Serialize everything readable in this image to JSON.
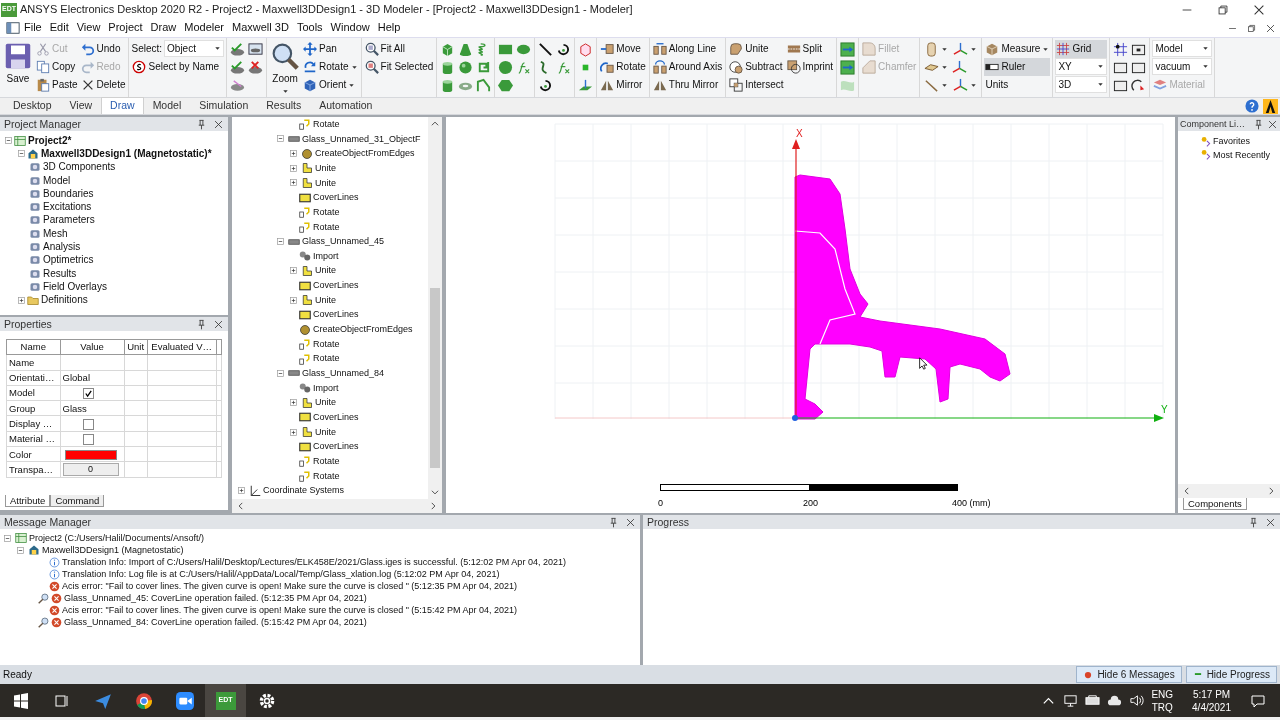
{
  "window": {
    "logo": "EDT",
    "title": "ANSYS Electronics Desktop 2020 R2 - Project2 - Maxwell3DDesign1 - 3D Modeler - [Project2 - Maxwell3DDesign1 - Modeler]"
  },
  "menu": [
    "File",
    "Edit",
    "View",
    "Project",
    "Draw",
    "Modeler",
    "Maxwell 3D",
    "Tools",
    "Window",
    "Help"
  ],
  "ribbon": {
    "groups": [
      {
        "items": [
          {
            "label": "Save"
          },
          {
            "label": "Cut",
            "disabled": true
          },
          {
            "label": "Copy",
            "disabled": false
          },
          {
            "label": "Paste",
            "disabled": false
          },
          {
            "label": "Undo",
            "disabled": false
          },
          {
            "label": "Redo",
            "disabled": true
          },
          {
            "label": "Delete",
            "disabled": false
          }
        ]
      },
      {
        "items": [
          {
            "label": "Select:",
            "value": "Object"
          },
          {
            "label": "Select by Name"
          }
        ]
      },
      {
        "items": [
          {
            "label": "Zoom"
          },
          {
            "label": "Pan"
          },
          {
            "label": "Rotate"
          },
          {
            "label": "Orient"
          }
        ]
      },
      {
        "items": [
          {
            "label": "Fit All"
          },
          {
            "label": "Fit Selected"
          }
        ]
      },
      {
        "items": [
          {
            "label": "Move"
          },
          {
            "label": "Rotate"
          },
          {
            "label": "Mirror"
          }
        ]
      },
      {
        "items": [
          {
            "label": "Along Line"
          },
          {
            "label": "Around Axis"
          },
          {
            "label": "Thru Mirror"
          }
        ]
      },
      {
        "items": [
          {
            "label": "Unite"
          },
          {
            "label": "Subtract"
          },
          {
            "label": "Intersect"
          },
          {
            "label": "Split"
          },
          {
            "label": "Imprint"
          }
        ]
      },
      {
        "items": [
          {
            "label": "Fillet",
            "disabled": true
          },
          {
            "label": "Chamfer",
            "disabled": true
          }
        ]
      },
      {
        "items": [
          {
            "label": "Measure",
            "selected": false
          },
          {
            "label": "Ruler",
            "selected": true
          },
          {
            "label": "Units",
            "selected": false
          }
        ]
      },
      {
        "items": [
          {
            "label": "Grid",
            "selected": true
          },
          {
            "value": "XY"
          },
          {
            "value": "3D"
          }
        ]
      },
      {
        "items": [
          {
            "value": "Model"
          },
          {
            "value": "vacuum"
          },
          {
            "label": "Material",
            "disabled": true
          }
        ]
      }
    ]
  },
  "ribbon_tabs": [
    {
      "label": "Desktop",
      "selected": false
    },
    {
      "label": "View",
      "selected": false
    },
    {
      "label": "Draw",
      "selected": true
    },
    {
      "label": "Model",
      "selected": false
    },
    {
      "label": "Simulation",
      "selected": false
    },
    {
      "label": "Results",
      "selected": false
    },
    {
      "label": "Automation",
      "selected": false
    }
  ],
  "project_manager": {
    "title": "Project Manager",
    "tree": [
      {
        "label": "Project2*",
        "expanded": true,
        "children": [
          {
            "label": "Maxwell3DDesign1 (Magnetostatic)*",
            "expanded": true,
            "children": [
              {
                "label": "3D Components"
              },
              {
                "label": "Model"
              },
              {
                "label": "Boundaries"
              },
              {
                "label": "Excitations"
              },
              {
                "label": "Parameters"
              },
              {
                "label": "Mesh"
              },
              {
                "label": "Analysis"
              },
              {
                "label": "Optimetrics"
              },
              {
                "label": "Results"
              },
              {
                "label": "Field Overlays"
              }
            ]
          },
          {
            "label": "Definitions",
            "expanded": false
          }
        ]
      }
    ]
  },
  "properties": {
    "title": "Properties",
    "columns": [
      "Name",
      "Value",
      "Unit",
      "Evaluated V…"
    ],
    "rows": [
      {
        "name": "Name",
        "kind": "text"
      },
      {
        "name": "Orientati…",
        "kind": "text",
        "value": "Global"
      },
      {
        "name": "Model",
        "kind": "checkbox",
        "checked": true
      },
      {
        "name": "Group",
        "kind": "text",
        "value": "Glass"
      },
      {
        "name": "Display …",
        "kind": "checkbox",
        "checked": false
      },
      {
        "name": "Material …",
        "kind": "checkbox",
        "checked": false
      },
      {
        "name": "Color",
        "kind": "color",
        "color": "#ff0000"
      },
      {
        "name": "Transpa…",
        "kind": "number",
        "value": "0"
      }
    ],
    "tabs": [
      {
        "label": "Attribute",
        "selected": true
      },
      {
        "label": "Command",
        "selected": false
      }
    ]
  },
  "history_tree": {
    "items": [
      {
        "children": [
          {
            "label": "Rotate",
            "kind": "rotate"
          }
        ]
      },
      {
        "label": "Glass_Unnamed_31_ObjectF",
        "expanded": true,
        "children": [
          {
            "label": "CreateObjectFromEdges",
            "kind": "create",
            "expanded": false
          },
          {
            "label": "Unite",
            "kind": "unite",
            "expanded": false
          },
          {
            "label": "Unite",
            "kind": "unite",
            "expanded": false
          },
          {
            "label": "CoverLines",
            "kind": "cover"
          },
          {
            "label": "Rotate",
            "kind": "rotate"
          },
          {
            "label": "Rotate",
            "kind": "rotate"
          }
        ]
      },
      {
        "label": "Glass_Unnamed_45",
        "expanded": true,
        "children": [
          {
            "label": "Import",
            "kind": "import"
          },
          {
            "label": "Unite",
            "kind": "unite",
            "expanded": false
          },
          {
            "label": "CoverLines",
            "kind": "cover"
          },
          {
            "label": "Unite",
            "kind": "unite",
            "expanded": false
          },
          {
            "label": "CoverLines",
            "kind": "cover"
          },
          {
            "label": "CreateObjectFromEdges",
            "kind": "create"
          },
          {
            "label": "Rotate",
            "kind": "rotate"
          },
          {
            "label": "Rotate",
            "kind": "rotate"
          }
        ]
      },
      {
        "label": "Glass_Unnamed_84",
        "expanded": true,
        "children": [
          {
            "label": "Import",
            "kind": "import"
          },
          {
            "label": "Unite",
            "kind": "unite",
            "expanded": false
          },
          {
            "label": "CoverLines",
            "kind": "cover"
          },
          {
            "label": "Unite",
            "kind": "unite",
            "expanded": false
          },
          {
            "label": "CoverLines",
            "kind": "cover"
          },
          {
            "label": "Rotate",
            "kind": "rotate"
          },
          {
            "label": "Rotate",
            "kind": "rotate"
          }
        ]
      }
    ],
    "root_items": [
      {
        "label": "Coordinate Systems",
        "expanded": false
      }
    ]
  },
  "viewport": {
    "axis_labels": [
      "X",
      "Y"
    ],
    "ruler_labels": [
      "0",
      "200",
      "400 (mm)"
    ]
  },
  "component_library": {
    "title": "Component Li…",
    "items": [
      "Favorites",
      "Most Recently"
    ],
    "tabs": [
      {
        "label": "Components",
        "selected": true
      }
    ]
  },
  "message_manager": {
    "title": "Message Manager",
    "project": "Project2 (C:/Users/Halil/Documents/Ansoft/)",
    "design": "Maxwell3DDesign1 (Magnetostatic)",
    "messages": [
      {
        "kind": "info",
        "locatable": false,
        "text": "Translation Info: Import of C:/Users/Halil/Desktop/Lectures/ELK458E/2021/Glass.iges is successful. (5:12:02 PM Apr 04, 2021)"
      },
      {
        "kind": "info",
        "locatable": false,
        "text": "Translation Info: Log file is at C:/Users/Halil/AppData/Local/Temp/Glass_xlation.log (5:12:02 PM Apr 04, 2021)"
      },
      {
        "kind": "error",
        "locatable": false,
        "text": "Acis error: \"Fail to cover lines. The given curve is open! Make sure the curve is closed \" (5:12:35 PM Apr 04, 2021)"
      },
      {
        "kind": "error",
        "locatable": true,
        "text": "Glass_Unnamed_45: CoverLine operation failed. (5:12:35 PM Apr 04, 2021)"
      },
      {
        "kind": "error",
        "locatable": false,
        "text": "Acis error: \"Fail to cover lines. The given curve is open! Make sure the curve is closed \" (5:15:42 PM Apr 04, 2021)"
      },
      {
        "kind": "error",
        "locatable": true,
        "text": "Glass_Unnamed_84: CoverLine operation failed. (5:15:42 PM Apr 04, 2021)"
      }
    ]
  },
  "progress": {
    "title": "Progress"
  },
  "status_bar": {
    "text": "Ready",
    "buttons": [
      "Hide 6 Messages",
      "Hide Progress"
    ]
  },
  "taskbar": {
    "apps": [
      {
        "kind": "plane",
        "selected": false
      },
      {
        "kind": "browser",
        "selected": false
      },
      {
        "kind": "camera",
        "selected": false
      },
      {
        "kind": "edt",
        "label": "EDT",
        "selected": true
      },
      {
        "kind": "gear",
        "selected": false
      }
    ],
    "language": "ENG",
    "layout": "TRQ",
    "time": "5:17 PM",
    "date": "4/4/2021"
  }
}
